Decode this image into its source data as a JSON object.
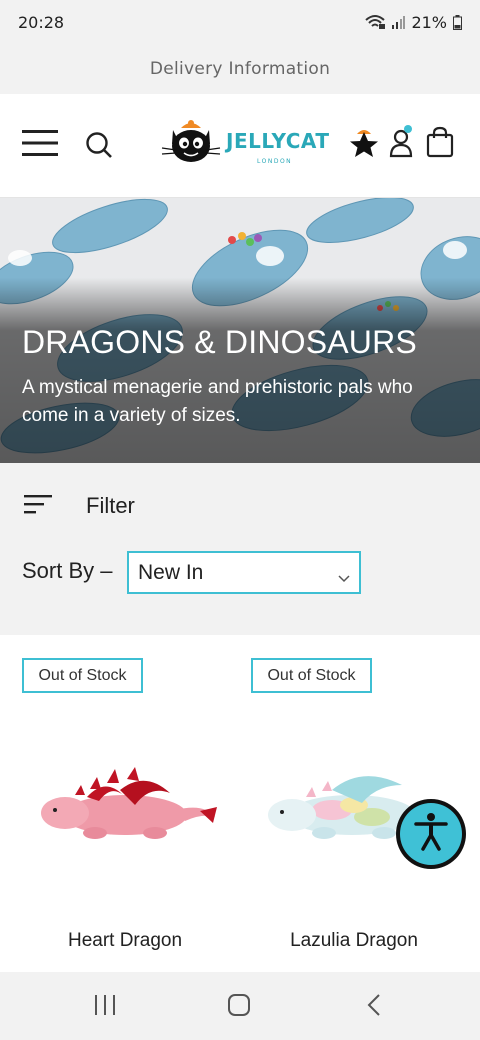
{
  "status": {
    "time": "20:28",
    "battery": "21%"
  },
  "delivery": {
    "label": "Delivery Information"
  },
  "header": {
    "brand": "JELLYCAT",
    "brand_sub": "LONDON"
  },
  "hero": {
    "title": "DRAGONS & DINOSAURS",
    "description": "A mystical menagerie and prehistoric pals who come in a variety of sizes."
  },
  "controls": {
    "filter_label": "Filter",
    "sort_label": "Sort By –",
    "sort_value": "New In"
  },
  "products": [
    {
      "badge": "Out of Stock",
      "name": "Heart Dragon"
    },
    {
      "badge": "Out of Stock",
      "name": "Lazulia Dragon"
    }
  ],
  "colors": {
    "accent": "#3ebfd3",
    "brand": "#2aa8b8",
    "a11y": "#3fc1d6"
  }
}
